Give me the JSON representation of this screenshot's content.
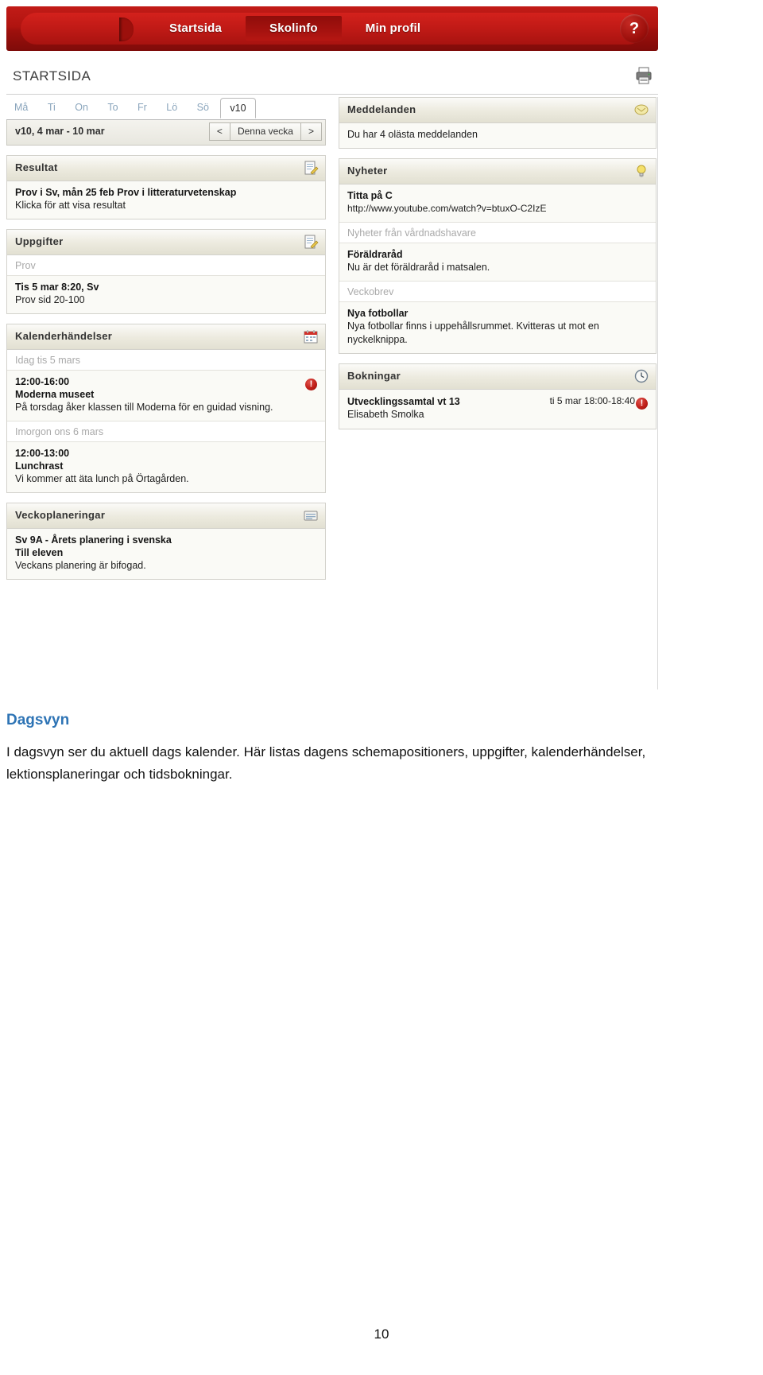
{
  "nav": {
    "items": [
      {
        "label": "Startsida",
        "state": "active"
      },
      {
        "label": "Skolinfo",
        "state": "raised"
      },
      {
        "label": "Min profil",
        "state": "normal"
      }
    ],
    "help_label": "?"
  },
  "header": {
    "page_title": "STARTSIDA",
    "print_icon": "printer-icon"
  },
  "week_tabs": {
    "days": [
      "Må",
      "Ti",
      "On",
      "To",
      "Fr",
      "Lö",
      "Sö"
    ],
    "selected_tab": "v10",
    "range_label": "v10, 4 mar - 10 mar",
    "prev_label": "<",
    "this_week_label": "Denna vecka",
    "next_label": ">"
  },
  "left_column": {
    "resultat": {
      "title": "Resultat",
      "icon": "document-edit-icon",
      "items": [
        {
          "title": "Prov i Sv, mån 25 feb Prov i litteraturvetenskap",
          "text": "Klicka för att visa resultat"
        }
      ]
    },
    "uppgifter": {
      "title": "Uppgifter",
      "icon": "document-edit-icon",
      "group_label": "Prov",
      "items": [
        {
          "title": "Tis 5 mar 8:20, Sv",
          "text": "Prov sid 20-100"
        }
      ]
    },
    "kalenderhandelser": {
      "title": "Kalenderhändelser",
      "icon": "calendar-icon",
      "groups": [
        {
          "label": "Idag tis 5 mars",
          "items": [
            {
              "time": "12:00-16:00",
              "title": "Moderna museet",
              "text": "På torsdag åker klassen till Moderna för en guidad visning.",
              "alert": "!"
            }
          ]
        },
        {
          "label": "Imorgon ons 6 mars",
          "items": [
            {
              "time": "12:00-13:00",
              "title": "Lunchrast",
              "text": "Vi kommer att äta lunch på Örtagården.",
              "alert": ""
            }
          ]
        }
      ]
    },
    "veckoplaneringar": {
      "title": "Veckoplaneringar",
      "icon": "note-icon",
      "items": [
        {
          "title": "Sv 9A - Årets planering i svenska",
          "subtitle": "Till eleven",
          "text": "Veckans planering är bifogad."
        }
      ]
    }
  },
  "right_column": {
    "meddelanden": {
      "title": "Meddelanden",
      "icon": "envelope-icon",
      "text": "Du har 4 olästa meddelanden"
    },
    "nyheter": {
      "title": "Nyheter",
      "icon": "lightbulb-icon",
      "items": [
        {
          "title": "Titta på C",
          "text": "http://www.youtube.com/watch?v=btuxO-C2IzE"
        }
      ],
      "groups": [
        {
          "label": "Nyheter från vårdnadshavare",
          "items": [
            {
              "title": "Föräldraråd",
              "text": "Nu är det föräldraråd i matsalen."
            }
          ]
        },
        {
          "label": "Veckobrev",
          "items": [
            {
              "title": "Nya fotbollar",
              "text": "Nya fotbollar finns i uppehållsrummet. Kvitteras ut mot en nyckelknippa."
            }
          ]
        }
      ]
    },
    "bokningar": {
      "title": "Bokningar",
      "icon": "clock-icon",
      "items": [
        {
          "title": "Utvecklingssamtal vt 13",
          "person": "Elisabeth Smolka",
          "when": "ti 5 mar 18:00-18:40",
          "alert": "!"
        }
      ]
    }
  },
  "caption": {
    "title": "Dagsvyn",
    "body": "I dagsvyn ser du aktuell dags kalender. Här listas dagens schemapositioners, uppgifter, kalenderhändelser, lektionsplaneringar och tidsbokningar."
  },
  "footer": {
    "page_number": "10"
  },
  "colors": {
    "brand_red": "#b01410",
    "caption_blue": "#2e74b5",
    "panel_bg": "#fafaf6"
  }
}
